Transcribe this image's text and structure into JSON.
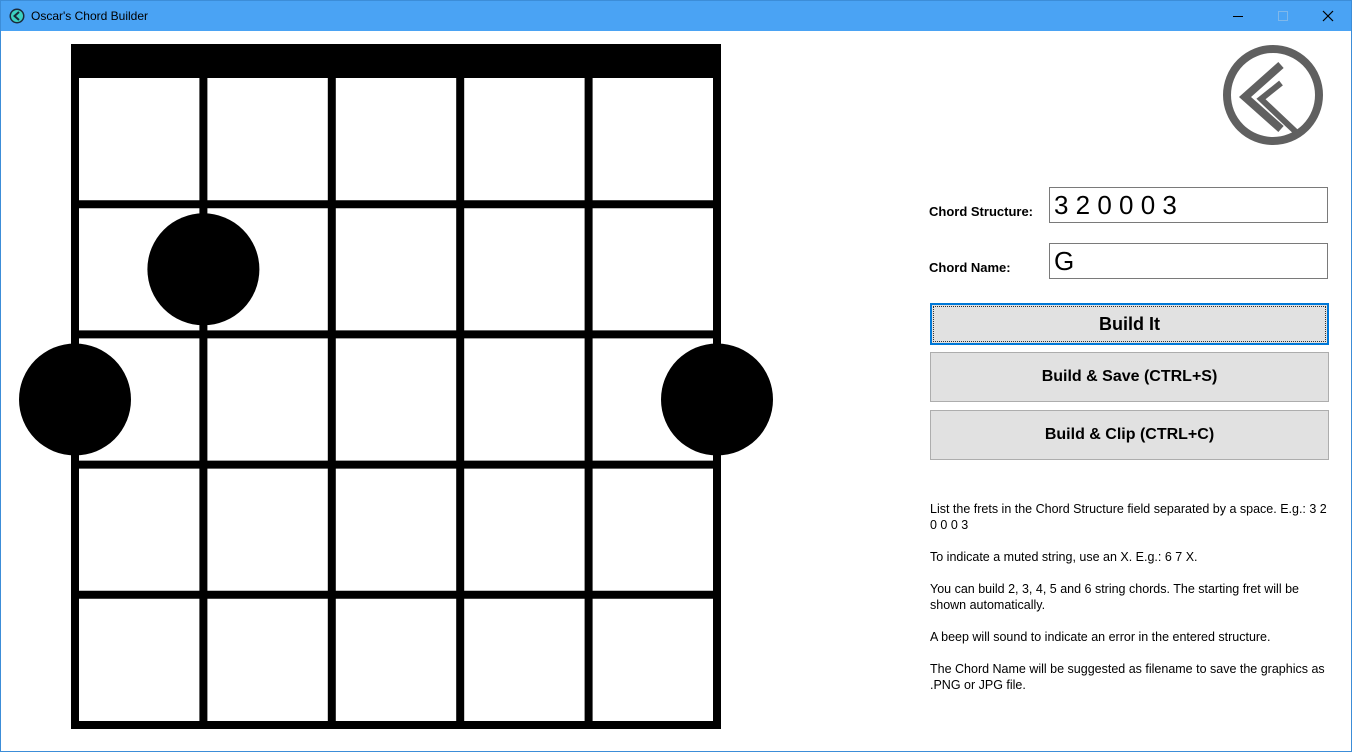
{
  "window": {
    "title": "Oscar's Chord Builder",
    "controls": [
      "minimize",
      "maximize",
      "close"
    ]
  },
  "form": {
    "structure_label": "Chord Structure:",
    "structure_value": "3 2 0 0 0 3",
    "name_label": "Chord Name:",
    "name_value": "G"
  },
  "buttons": {
    "build": "Build It",
    "build_save": "Build & Save (CTRL+S)",
    "build_clip": "Build & Clip (CTRL+C)"
  },
  "help": [
    "List the frets in the Chord Structure field separated by a space. E.g.: 3 2 0 0 0 3",
    "To indicate a muted string, use an X. E.g.: 6 7 X.",
    "You can build 2, 3, 4, 5 and 6 string chords. The starting fret will be shown automatically.",
    "A beep will sound to indicate an error in the entered structure.",
    "The Chord Name will be suggested as filename to save the graphics as .PNG or JPG file."
  ],
  "diagram": {
    "strings": 6,
    "frets": 5,
    "chord": [
      3,
      2,
      0,
      0,
      0,
      3
    ],
    "colors": {
      "lines": "#000000",
      "dots": "#000000"
    }
  },
  "colors": {
    "titlebar": "#4aa3f4",
    "accent": "#0078d7",
    "button": "#e1e1e1",
    "logo": "#606060"
  }
}
